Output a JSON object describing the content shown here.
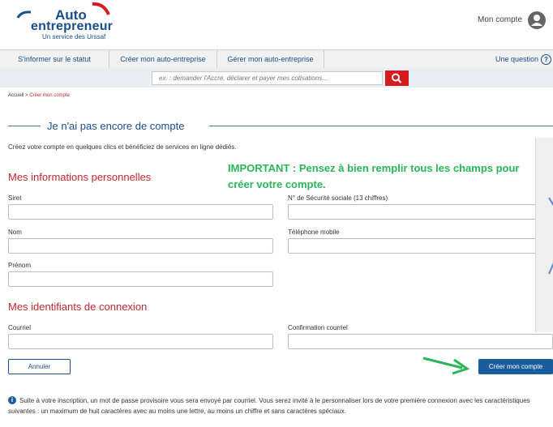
{
  "header": {
    "logo_line1": "Auto",
    "logo_line2": "entrepreneur",
    "logo_sub": "Un service des Urssaf",
    "account_label": "Mon compte"
  },
  "nav": {
    "items": [
      "S'informer sur le statut",
      "Créer mon auto-entreprise",
      "Gérer mon auto-entreprise"
    ],
    "question_label": "Une question",
    "question_icon": "?"
  },
  "search": {
    "placeholder": "ex. : demander l'Accre, déclarer et payer mes cotisations..."
  },
  "breadcrumb": {
    "home": "Accueil",
    "separator": " > ",
    "current": "Créer mon compte"
  },
  "page": {
    "title": "Je n'ai pas encore de compte",
    "intro": "Créez votre compte en quelques clics et bénéficiez de services en ligne dédiés.",
    "important": "IMPORTANT : Pensez à bien remplir tous les champs pour créer votre compte."
  },
  "section_personal": {
    "heading": "Mes informations personnelles",
    "fields": {
      "siret": "Siret",
      "nss": "N° de Sécurité sociale (13 chiffres)",
      "nom": "Nom",
      "telephone": "Téléphone mobile",
      "prenom": "Prénom"
    }
  },
  "section_login": {
    "heading": "Mes identifiants de connexion",
    "fields": {
      "courriel": "Courriel",
      "confirmation": "Confirmation courriel"
    }
  },
  "actions": {
    "cancel": "Annuler",
    "create": "Créer mon compte"
  },
  "info": {
    "icon": "i",
    "text": "Suite à votre inscription, un mot de passe provisoire vous sera envoyé par courriel. Vous serez invité à le personnaliser lors de votre première connexion avec les caractéristiques suivantes : un maximum de huit caractères avec au moins une lettre, au moins un chiffre et sans caractères spéciaux."
  },
  "colors": {
    "brand_blue": "#1a4e8a",
    "accent_red": "#c1272d",
    "important_green": "#2bb55a",
    "button_blue": "#1a5d9e"
  }
}
